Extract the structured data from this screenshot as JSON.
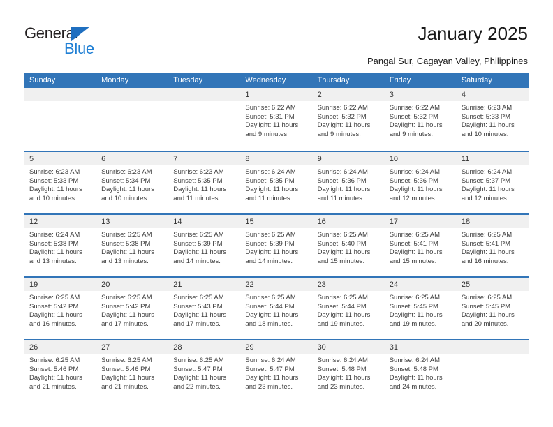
{
  "brand": {
    "name_part1": "General",
    "name_part2": "Blue",
    "triangle_color": "#1f6fc0",
    "blue_color": "#1f7fd4"
  },
  "header": {
    "title": "January 2025",
    "subtitle": "Pangal Sur, Cagayan Valley, Philippines"
  },
  "theme": {
    "header_band": "#3275b8",
    "day_strip": "#f0f0f0",
    "text": "#3d3d3d"
  },
  "weekdays": [
    "Sunday",
    "Monday",
    "Tuesday",
    "Wednesday",
    "Thursday",
    "Friday",
    "Saturday"
  ],
  "calendar_data": {
    "month": "January",
    "year": "2025",
    "location": "Pangal Sur, Cagayan Valley, Philippines",
    "weeks": [
      [
        {
          "day": ""
        },
        {
          "day": ""
        },
        {
          "day": ""
        },
        {
          "day": "1",
          "sunrise": "Sunrise: 6:22 AM",
          "sunset": "Sunset: 5:31 PM",
          "daylight_l1": "Daylight: 11 hours",
          "daylight_l2": "and 9 minutes."
        },
        {
          "day": "2",
          "sunrise": "Sunrise: 6:22 AM",
          "sunset": "Sunset: 5:32 PM",
          "daylight_l1": "Daylight: 11 hours",
          "daylight_l2": "and 9 minutes."
        },
        {
          "day": "3",
          "sunrise": "Sunrise: 6:22 AM",
          "sunset": "Sunset: 5:32 PM",
          "daylight_l1": "Daylight: 11 hours",
          "daylight_l2": "and 9 minutes."
        },
        {
          "day": "4",
          "sunrise": "Sunrise: 6:23 AM",
          "sunset": "Sunset: 5:33 PM",
          "daylight_l1": "Daylight: 11 hours",
          "daylight_l2": "and 10 minutes."
        }
      ],
      [
        {
          "day": "5",
          "sunrise": "Sunrise: 6:23 AM",
          "sunset": "Sunset: 5:33 PM",
          "daylight_l1": "Daylight: 11 hours",
          "daylight_l2": "and 10 minutes."
        },
        {
          "day": "6",
          "sunrise": "Sunrise: 6:23 AM",
          "sunset": "Sunset: 5:34 PM",
          "daylight_l1": "Daylight: 11 hours",
          "daylight_l2": "and 10 minutes."
        },
        {
          "day": "7",
          "sunrise": "Sunrise: 6:23 AM",
          "sunset": "Sunset: 5:35 PM",
          "daylight_l1": "Daylight: 11 hours",
          "daylight_l2": "and 11 minutes."
        },
        {
          "day": "8",
          "sunrise": "Sunrise: 6:24 AM",
          "sunset": "Sunset: 5:35 PM",
          "daylight_l1": "Daylight: 11 hours",
          "daylight_l2": "and 11 minutes."
        },
        {
          "day": "9",
          "sunrise": "Sunrise: 6:24 AM",
          "sunset": "Sunset: 5:36 PM",
          "daylight_l1": "Daylight: 11 hours",
          "daylight_l2": "and 11 minutes."
        },
        {
          "day": "10",
          "sunrise": "Sunrise: 6:24 AM",
          "sunset": "Sunset: 5:36 PM",
          "daylight_l1": "Daylight: 11 hours",
          "daylight_l2": "and 12 minutes."
        },
        {
          "day": "11",
          "sunrise": "Sunrise: 6:24 AM",
          "sunset": "Sunset: 5:37 PM",
          "daylight_l1": "Daylight: 11 hours",
          "daylight_l2": "and 12 minutes."
        }
      ],
      [
        {
          "day": "12",
          "sunrise": "Sunrise: 6:24 AM",
          "sunset": "Sunset: 5:38 PM",
          "daylight_l1": "Daylight: 11 hours",
          "daylight_l2": "and 13 minutes."
        },
        {
          "day": "13",
          "sunrise": "Sunrise: 6:25 AM",
          "sunset": "Sunset: 5:38 PM",
          "daylight_l1": "Daylight: 11 hours",
          "daylight_l2": "and 13 minutes."
        },
        {
          "day": "14",
          "sunrise": "Sunrise: 6:25 AM",
          "sunset": "Sunset: 5:39 PM",
          "daylight_l1": "Daylight: 11 hours",
          "daylight_l2": "and 14 minutes."
        },
        {
          "day": "15",
          "sunrise": "Sunrise: 6:25 AM",
          "sunset": "Sunset: 5:39 PM",
          "daylight_l1": "Daylight: 11 hours",
          "daylight_l2": "and 14 minutes."
        },
        {
          "day": "16",
          "sunrise": "Sunrise: 6:25 AM",
          "sunset": "Sunset: 5:40 PM",
          "daylight_l1": "Daylight: 11 hours",
          "daylight_l2": "and 15 minutes."
        },
        {
          "day": "17",
          "sunrise": "Sunrise: 6:25 AM",
          "sunset": "Sunset: 5:41 PM",
          "daylight_l1": "Daylight: 11 hours",
          "daylight_l2": "and 15 minutes."
        },
        {
          "day": "18",
          "sunrise": "Sunrise: 6:25 AM",
          "sunset": "Sunset: 5:41 PM",
          "daylight_l1": "Daylight: 11 hours",
          "daylight_l2": "and 16 minutes."
        }
      ],
      [
        {
          "day": "19",
          "sunrise": "Sunrise: 6:25 AM",
          "sunset": "Sunset: 5:42 PM",
          "daylight_l1": "Daylight: 11 hours",
          "daylight_l2": "and 16 minutes."
        },
        {
          "day": "20",
          "sunrise": "Sunrise: 6:25 AM",
          "sunset": "Sunset: 5:42 PM",
          "daylight_l1": "Daylight: 11 hours",
          "daylight_l2": "and 17 minutes."
        },
        {
          "day": "21",
          "sunrise": "Sunrise: 6:25 AM",
          "sunset": "Sunset: 5:43 PM",
          "daylight_l1": "Daylight: 11 hours",
          "daylight_l2": "and 17 minutes."
        },
        {
          "day": "22",
          "sunrise": "Sunrise: 6:25 AM",
          "sunset": "Sunset: 5:44 PM",
          "daylight_l1": "Daylight: 11 hours",
          "daylight_l2": "and 18 minutes."
        },
        {
          "day": "23",
          "sunrise": "Sunrise: 6:25 AM",
          "sunset": "Sunset: 5:44 PM",
          "daylight_l1": "Daylight: 11 hours",
          "daylight_l2": "and 19 minutes."
        },
        {
          "day": "24",
          "sunrise": "Sunrise: 6:25 AM",
          "sunset": "Sunset: 5:45 PM",
          "daylight_l1": "Daylight: 11 hours",
          "daylight_l2": "and 19 minutes."
        },
        {
          "day": "25",
          "sunrise": "Sunrise: 6:25 AM",
          "sunset": "Sunset: 5:45 PM",
          "daylight_l1": "Daylight: 11 hours",
          "daylight_l2": "and 20 minutes."
        }
      ],
      [
        {
          "day": "26",
          "sunrise": "Sunrise: 6:25 AM",
          "sunset": "Sunset: 5:46 PM",
          "daylight_l1": "Daylight: 11 hours",
          "daylight_l2": "and 21 minutes."
        },
        {
          "day": "27",
          "sunrise": "Sunrise: 6:25 AM",
          "sunset": "Sunset: 5:46 PM",
          "daylight_l1": "Daylight: 11 hours",
          "daylight_l2": "and 21 minutes."
        },
        {
          "day": "28",
          "sunrise": "Sunrise: 6:25 AM",
          "sunset": "Sunset: 5:47 PM",
          "daylight_l1": "Daylight: 11 hours",
          "daylight_l2": "and 22 minutes."
        },
        {
          "day": "29",
          "sunrise": "Sunrise: 6:24 AM",
          "sunset": "Sunset: 5:47 PM",
          "daylight_l1": "Daylight: 11 hours",
          "daylight_l2": "and 23 minutes."
        },
        {
          "day": "30",
          "sunrise": "Sunrise: 6:24 AM",
          "sunset": "Sunset: 5:48 PM",
          "daylight_l1": "Daylight: 11 hours",
          "daylight_l2": "and 23 minutes."
        },
        {
          "day": "31",
          "sunrise": "Sunrise: 6:24 AM",
          "sunset": "Sunset: 5:48 PM",
          "daylight_l1": "Daylight: 11 hours",
          "daylight_l2": "and 24 minutes."
        },
        {
          "day": ""
        }
      ]
    ]
  }
}
